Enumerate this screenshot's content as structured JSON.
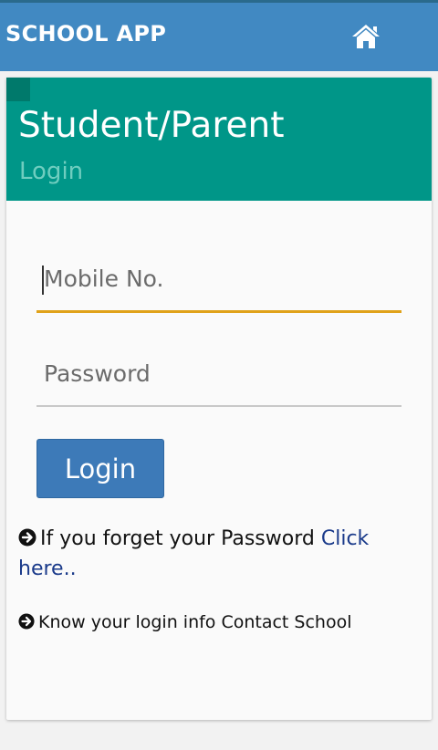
{
  "app": {
    "title": "SCHOOL APP",
    "home_icon": "home-icon"
  },
  "card": {
    "title": "Student/Parent",
    "subtitle": "Login"
  },
  "form": {
    "mobile_placeholder": "Mobile No.",
    "password_placeholder": "Password",
    "login_label": "Login"
  },
  "help": {
    "forgot_text": "If you forget your Password",
    "forgot_link": "Click here..",
    "contact_text": "Know your login info Contact School"
  },
  "colors": {
    "topbar": "#4189c2",
    "card_header": "#009688",
    "focus_underline": "#e0a21a",
    "button": "#3d7ab8",
    "link": "#1a3a8a"
  }
}
